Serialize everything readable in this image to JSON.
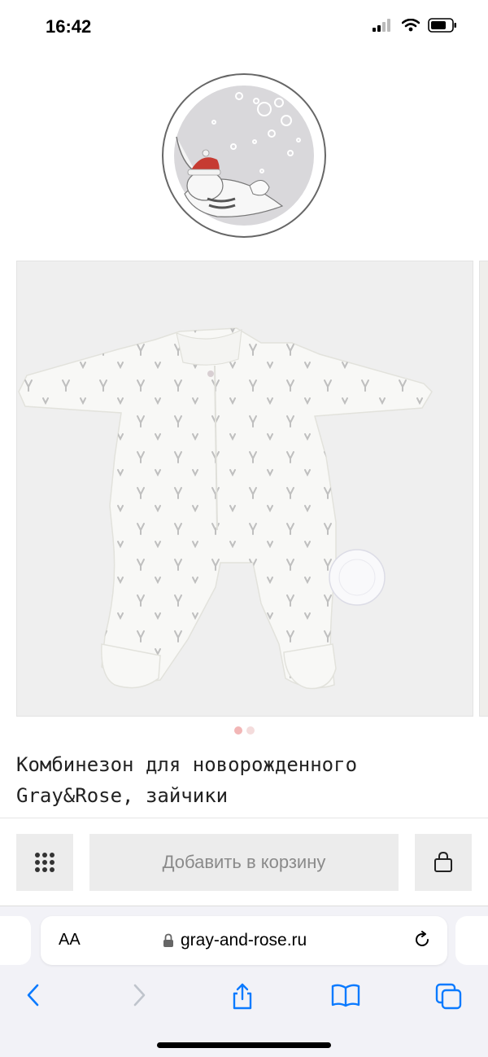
{
  "status_bar": {
    "time": "16:42"
  },
  "product": {
    "title_line1": "Комбинезон для новорожденного",
    "title_line2": "Gray&Rose, зайчики"
  },
  "gallery": {
    "image_count": 2,
    "active_index": 0
  },
  "actions": {
    "add_to_cart_label": "Добавить в корзину"
  },
  "browser": {
    "aa_label": "AA",
    "url": "gray-and-rose.ru"
  },
  "icons": {
    "status": [
      "cellular-signal-icon",
      "wifi-icon",
      "battery-icon"
    ],
    "actions": [
      "grid-icon",
      "shopping-bag-icon"
    ],
    "address_bar": [
      "lock-icon",
      "reload-icon"
    ],
    "toolbar": [
      "back-icon",
      "forward-icon",
      "share-icon",
      "bookmarks-icon",
      "tabs-icon"
    ]
  },
  "colors": {
    "accent_dot": "#f2b6b6",
    "button_bg": "#ececec",
    "button_text": "#8a8a8a"
  }
}
